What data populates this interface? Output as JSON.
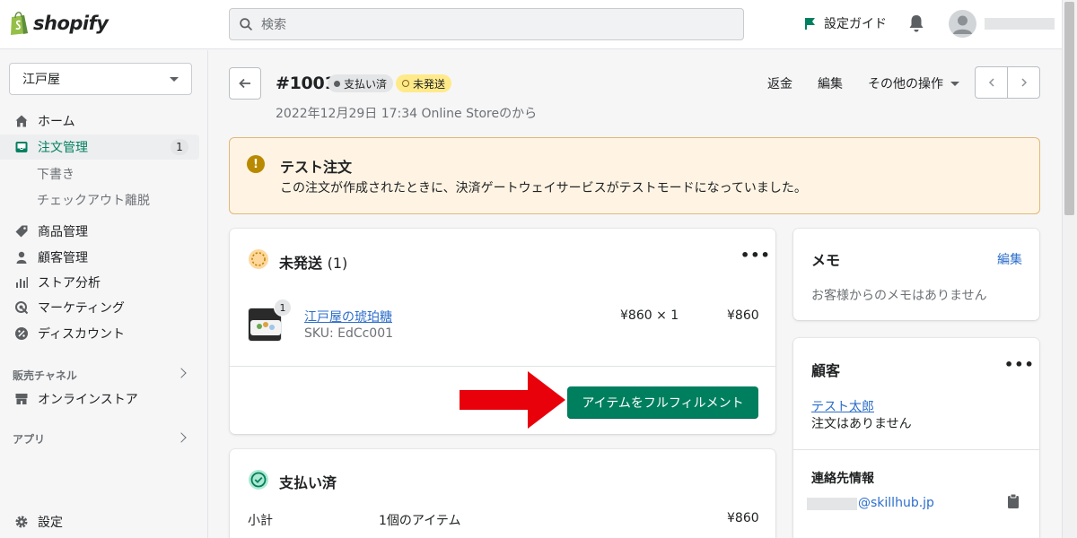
{
  "topbar": {
    "logo_text": "shopify",
    "search_placeholder": "検索",
    "setup_guide": "設定ガイド"
  },
  "sidebar": {
    "store_name": "江戸屋",
    "home": "ホーム",
    "orders": "注文管理",
    "orders_count": "1",
    "drafts": "下書き",
    "abandoned": "チェックアウト離脱",
    "products": "商品管理",
    "customers": "顧客管理",
    "analytics": "ストア分析",
    "marketing": "マーケティング",
    "discounts": "ディスカウント",
    "sales_channels": "販売チャネル",
    "online_store": "オンラインストア",
    "apps": "アプリ",
    "settings": "設定"
  },
  "order": {
    "number": "#1001",
    "status_paid": "支払い済",
    "status_unfulfilled": "未発送",
    "subtitle": "2022年12月29日 17:34 Online Storeのから",
    "refund": "返金",
    "edit": "編集",
    "more_actions": "その他の操作"
  },
  "banner": {
    "title": "テスト注文",
    "text": "この注文が作成されたときに、決済ゲートウェイサービスがテストモードになっていました。"
  },
  "unfulfilled_card": {
    "title": "未発送",
    "count": "(1)",
    "item_name": "江戸屋の琥珀糖",
    "sku": "SKU: EdCc001",
    "qty_badge": "1",
    "unit_price": "¥860 × 1",
    "total": "¥860",
    "fulfill_button": "アイテムをフルフィルメント"
  },
  "paid_card": {
    "title": "支払い済",
    "subtotal_label": "小計",
    "subtotal_items": "1個のアイテム",
    "subtotal_amount": "¥860"
  },
  "notes_card": {
    "title": "メモ",
    "edit": "編集",
    "empty": "お客様からのメモはありません"
  },
  "customer_card": {
    "title": "顧客",
    "name": "テスト太郎",
    "orders": "注文はありません",
    "contact_title": "連絡先情報",
    "email_domain": "@skillhub.jp"
  },
  "colors": {
    "accent_green": "#008060",
    "button_green": "#007f5f",
    "banner_bg": "#fff4e4",
    "arrow_red": "#e8000b"
  }
}
